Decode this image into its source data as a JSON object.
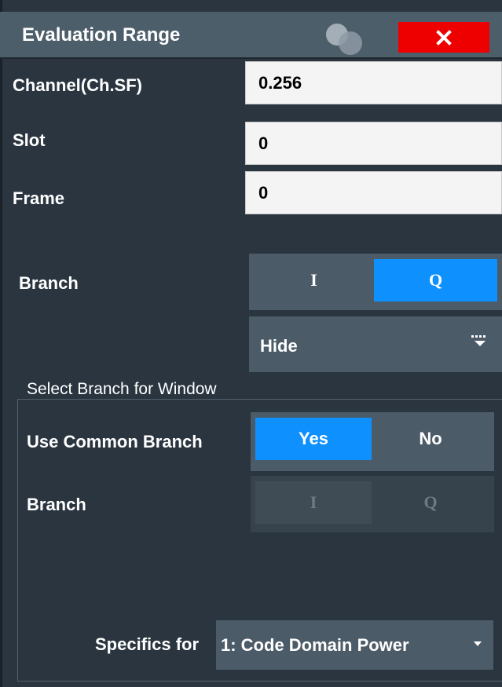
{
  "title": "Evaluation Range",
  "close_icon": "close-icon",
  "fields": {
    "channel": {
      "label": "Channel(Ch.SF)",
      "value": "0.256"
    },
    "slot": {
      "label": "Slot",
      "value": "0"
    },
    "frame": {
      "label": "Frame",
      "value": "0"
    }
  },
  "branch": {
    "label": "Branch",
    "options": [
      "I",
      "Q"
    ],
    "selected": "Q",
    "display_select": {
      "value": "Hide",
      "icon": "filter-icon"
    }
  },
  "select_branch_for_window": {
    "caption": "Select Branch for Window",
    "use_common_branch": {
      "label": "Use Common Branch",
      "options": [
        "Yes",
        "No"
      ],
      "selected": "Yes"
    },
    "branch": {
      "label": "Branch",
      "options": [
        "I",
        "Q"
      ],
      "disabled": true
    }
  },
  "specifics": {
    "label": "Specifics for",
    "value": "1: Code Domain Power",
    "icon": "caret-down-icon"
  },
  "colors": {
    "accent": "#0f90ff",
    "close": "#ee0000",
    "panel": "#2a3540",
    "titlebar": "#4d5e6b"
  }
}
